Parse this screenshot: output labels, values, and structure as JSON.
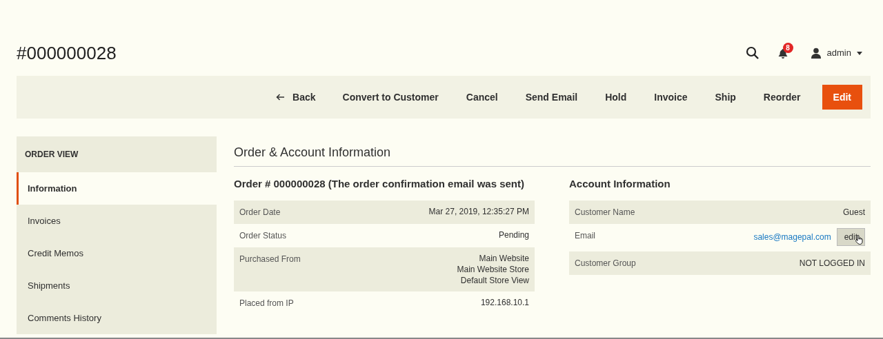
{
  "page_title": "#000000028",
  "header": {
    "notification_count": "8",
    "user": "admin"
  },
  "toolbar": [
    {
      "label": "Back",
      "kind": "back"
    },
    {
      "label": "Convert to Customer",
      "kind": "plain"
    },
    {
      "label": "Cancel",
      "kind": "plain"
    },
    {
      "label": "Send Email",
      "kind": "plain"
    },
    {
      "label": "Hold",
      "kind": "plain"
    },
    {
      "label": "Invoice",
      "kind": "plain"
    },
    {
      "label": "Ship",
      "kind": "plain"
    },
    {
      "label": "Reorder",
      "kind": "plain"
    },
    {
      "label": "Edit",
      "kind": "primary"
    }
  ],
  "sidebar": {
    "title": "ORDER VIEW",
    "items": [
      {
        "label": "Information",
        "selected": true
      },
      {
        "label": "Invoices",
        "selected": false
      },
      {
        "label": "Credit Memos",
        "selected": false
      },
      {
        "label": "Shipments",
        "selected": false
      },
      {
        "label": "Comments History",
        "selected": false
      }
    ]
  },
  "section_title": "Order & Account Information",
  "order": {
    "title": "Order # 000000028 (The order confirmation email was sent)",
    "rows": [
      {
        "label": "Order Date",
        "values": [
          "Mar 27, 2019, 12:35:27 PM"
        ]
      },
      {
        "label": "Order Status",
        "values": [
          "Pending"
        ]
      },
      {
        "label": "Purchased From",
        "values": [
          "Main Website",
          "Main Website Store",
          "Default Store View"
        ]
      },
      {
        "label": "Placed from IP",
        "values": [
          "192.168.10.1"
        ]
      }
    ]
  },
  "account": {
    "title": "Account Information",
    "rows": [
      {
        "label": "Customer Name",
        "kind": "text",
        "value": "Guest"
      },
      {
        "label": "Email",
        "kind": "email",
        "value": "sales@magepal.com",
        "button": "edit"
      },
      {
        "label": "Customer Group",
        "kind": "text",
        "value": "NOT LOGGED IN"
      }
    ]
  }
}
